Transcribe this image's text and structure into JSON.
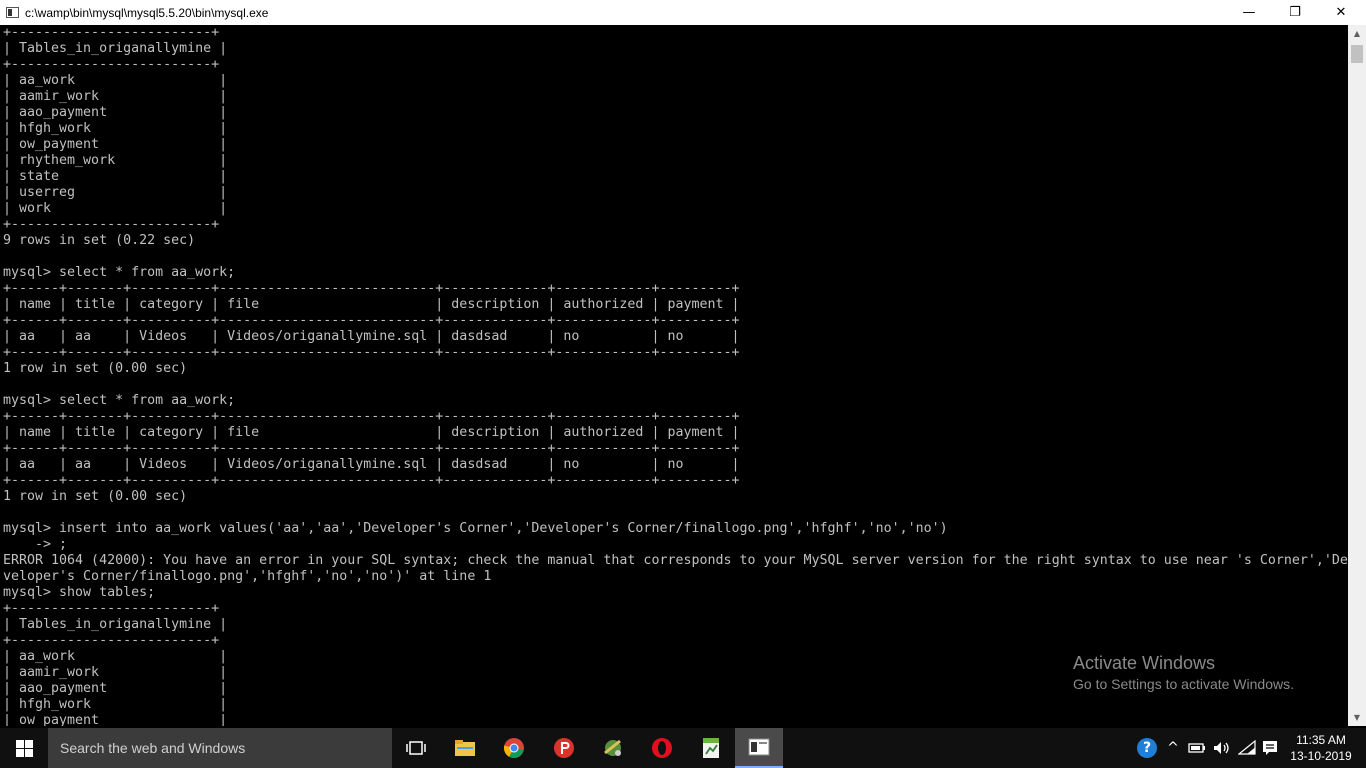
{
  "window": {
    "title": "c:\\wamp\\bin\\mysql\\mysql5.5.20\\bin\\mysql.exe",
    "minimize_glyph": "—",
    "maximize_glyph": "❐",
    "close_glyph": "✕"
  },
  "console": {
    "lines": [
      "+-------------------------+",
      "| Tables_in_origanallymine |",
      "+-------------------------+",
      "| aa_work                  |",
      "| aamir_work               |",
      "| aao_payment              |",
      "| hfgh_work                |",
      "| ow_payment               |",
      "| rhythem_work             |",
      "| state                    |",
      "| userreg                  |",
      "| work                     |",
      "+-------------------------+",
      "9 rows in set (0.22 sec)",
      "",
      "mysql> select * from aa_work;",
      "+------+-------+----------+---------------------------+-------------+------------+---------+",
      "| name | title | category | file                      | description | authorized | payment |",
      "+------+-------+----------+---------------------------+-------------+------------+---------+",
      "| aa   | aa    | Videos   | Videos/origanallymine.sql | dasdsad     | no         | no      |",
      "+------+-------+----------+---------------------------+-------------+------------+---------+",
      "1 row in set (0.00 sec)",
      "",
      "mysql> select * from aa_work;",
      "+------+-------+----------+---------------------------+-------------+------------+---------+",
      "| name | title | category | file                      | description | authorized | payment |",
      "+------+-------+----------+---------------------------+-------------+------------+---------+",
      "| aa   | aa    | Videos   | Videos/origanallymine.sql | dasdsad     | no         | no      |",
      "+------+-------+----------+---------------------------+-------------+------------+---------+",
      "1 row in set (0.00 sec)",
      "",
      "mysql> insert into aa_work values('aa','aa','Developer's Corner','Developer's Corner/finallogo.png','hfghf','no','no')",
      "    -> ;",
      "ERROR 1064 (42000): You have an error in your SQL syntax; check the manual that corresponds to your MySQL server version for the right syntax to use near 's Corner','De",
      "veloper's Corner/finallogo.png','hfghf','no','no')' at line 1",
      "mysql> show tables;",
      "+-------------------------+",
      "| Tables_in_origanallymine |",
      "+-------------------------+",
      "| aa_work                  |",
      "| aamir_work               |",
      "| aao_payment              |",
      "| hfgh_work                |",
      "| ow_payment               |"
    ]
  },
  "scrollbar": {
    "up_glyph": "▲",
    "down_glyph": "▼"
  },
  "watermark": {
    "title": "Activate Windows",
    "subtitle": "Go to Settings to activate Windows."
  },
  "taskbar": {
    "search_placeholder": "Search the web and Windows",
    "apps": [
      {
        "name": "task-view-icon"
      },
      {
        "name": "file-explorer-icon"
      },
      {
        "name": "chrome-icon"
      },
      {
        "name": "psiphon-icon"
      },
      {
        "name": "network-tool-icon"
      },
      {
        "name": "opera-icon"
      },
      {
        "name": "spreadsheet-icon"
      },
      {
        "name": "console-app-icon"
      }
    ],
    "tray": {
      "help_glyph": "?",
      "chevron_glyph": "^"
    },
    "clock": {
      "time": "11:35 AM",
      "date": "13-10-2019"
    }
  }
}
